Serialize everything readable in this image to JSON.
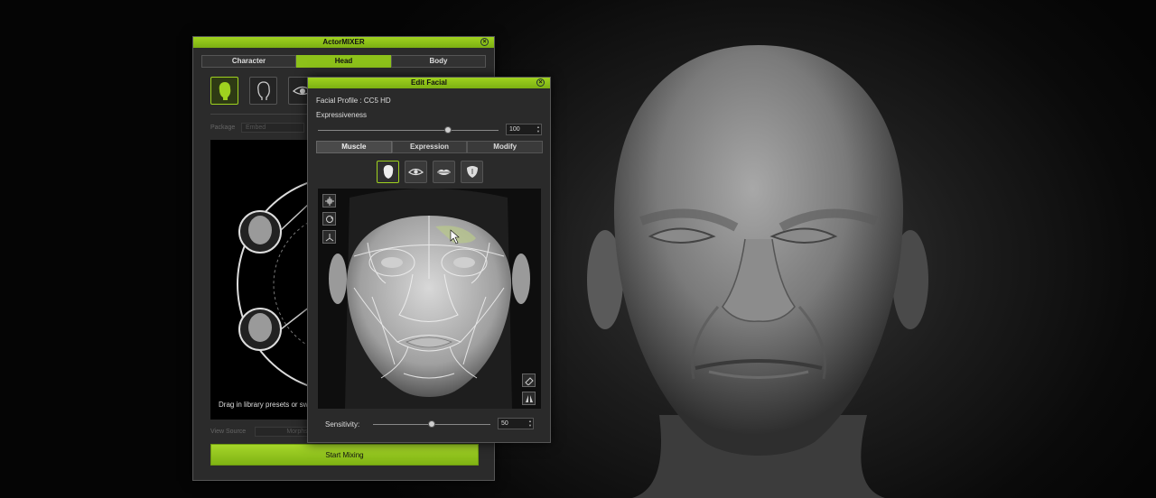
{
  "actormixer": {
    "title": "ActorMIXER",
    "tabs": [
      {
        "label": "Character",
        "active": false
      },
      {
        "label": "Head",
        "active": true
      },
      {
        "label": "Body",
        "active": false
      }
    ],
    "icons": [
      "head-silhouette-icon",
      "head-outline-icon",
      "eye-icon"
    ],
    "package_label": "Package",
    "package_value": "Embed",
    "hint": "Drag in library presets or swap",
    "view_source_label": "View Source",
    "view_source_value": "Morphs",
    "start_label": "Start Mixing"
  },
  "editfacial": {
    "title": "Edit Facial",
    "profile": "Facial Profile : CC5 HD",
    "expressiveness_label": "Expressiveness",
    "expressiveness_value": "100",
    "expressiveness_level": 0.72,
    "tabs": [
      {
        "label": "Muscle",
        "active": true
      },
      {
        "label": "Expression",
        "active": false
      },
      {
        "label": "Modify",
        "active": false
      }
    ],
    "region_icons": [
      "face-icon",
      "eye-icon",
      "lips-icon",
      "tongue-icon"
    ],
    "sensitivity_label": "Sensitivity:",
    "sensitivity_value": "50",
    "sensitivity_level": 0.5
  },
  "colors": {
    "accent": "#8dc21a",
    "panel": "#2b2b2b"
  }
}
